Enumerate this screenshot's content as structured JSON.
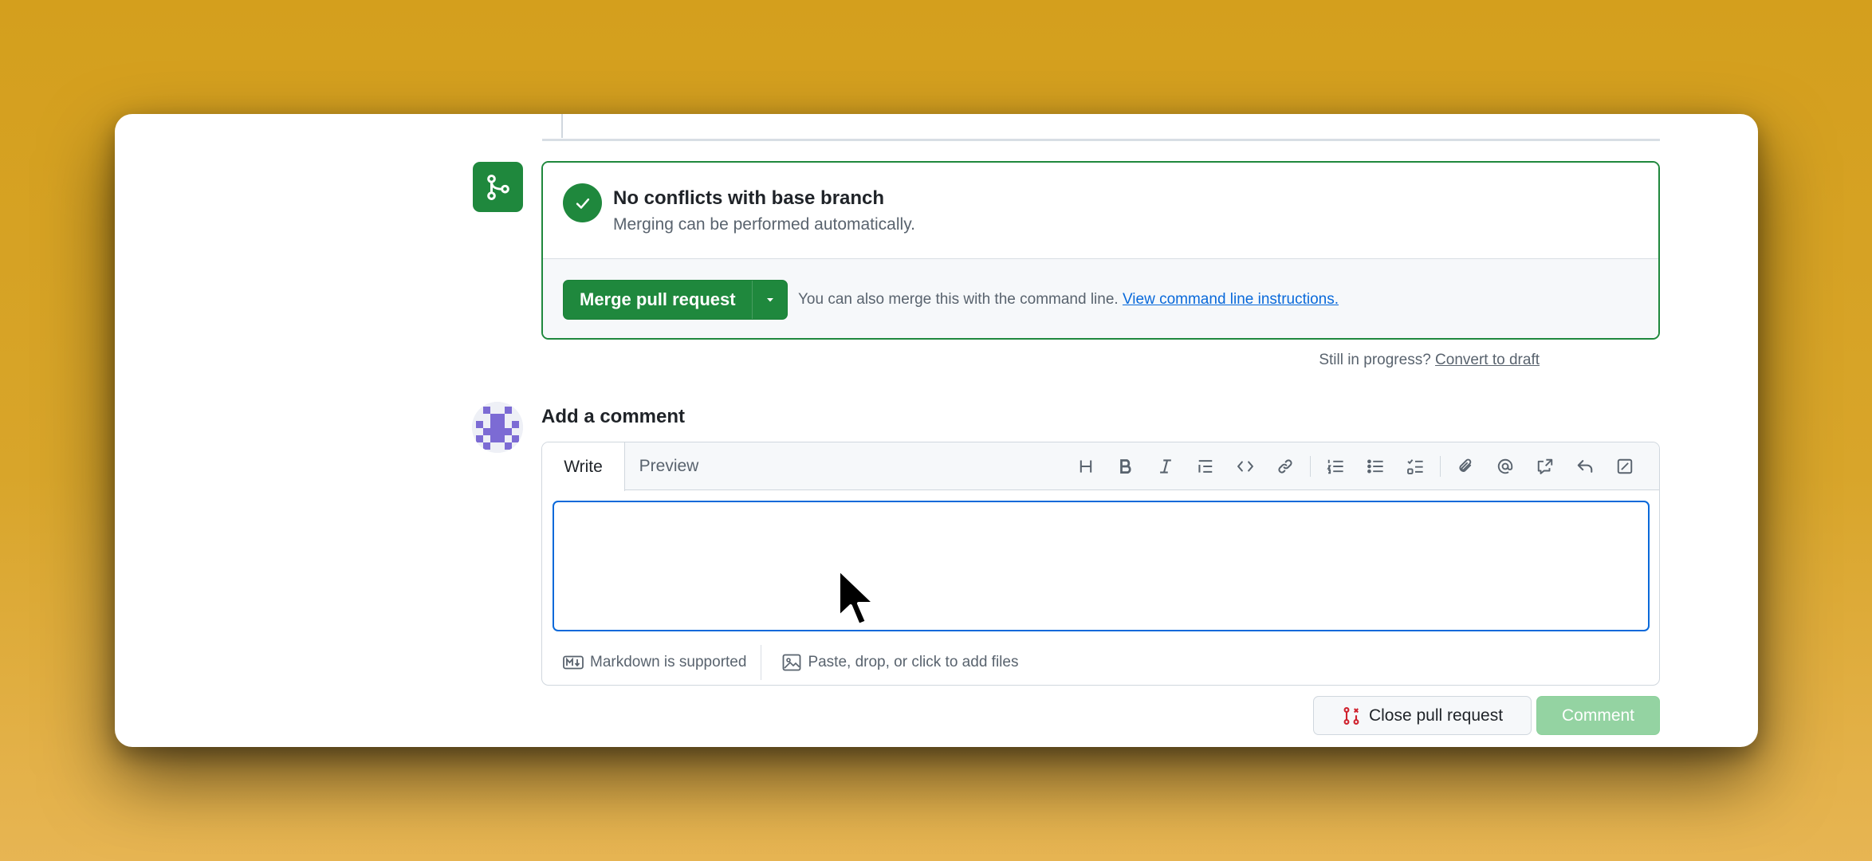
{
  "merge": {
    "title": "No conflicts with base branch",
    "subtitle": "Merging can be performed automatically.",
    "merge_button_label": "Merge pull request",
    "hint_prefix": "You can also merge this with the command line.",
    "hint_link": "View command line instructions.",
    "draft_prefix": "Still in progress?",
    "draft_link": "Convert to draft"
  },
  "comment": {
    "heading": "Add a comment",
    "tabs": [
      {
        "label": "Write",
        "active": true
      },
      {
        "label": "Preview",
        "active": false
      }
    ],
    "toolbar_icons": [
      "heading-icon",
      "bold-icon",
      "italic-icon",
      "quote-icon",
      "code-icon",
      "link-icon",
      "ordered-list-icon",
      "unordered-list-icon",
      "task-list-icon",
      "attach-icon",
      "mention-icon",
      "reference-icon",
      "reply-icon",
      "fullscreen-icon"
    ],
    "textarea_value": "",
    "markdown_label": "Markdown is supported",
    "files_label": "Paste, drop, or click to add files"
  },
  "actions": {
    "close_label": "Close pull request",
    "comment_label": "Comment"
  },
  "colors": {
    "accent_green": "#1f883d",
    "link_blue": "#0969da",
    "disabled_green": "#94d3a2",
    "danger_red": "#cf222e",
    "background": "#d8a52a"
  }
}
